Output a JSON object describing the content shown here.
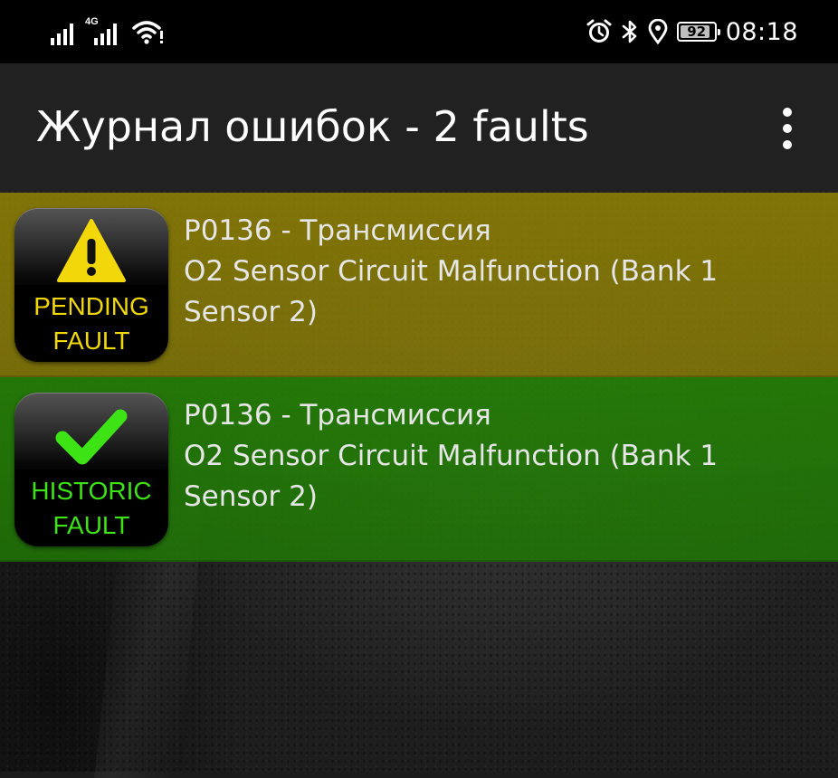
{
  "status_bar": {
    "time": "08:18",
    "battery_level": "92",
    "network_label": "4G",
    "icons": [
      "signal-icon",
      "4g-signal-icon",
      "wifi-icon",
      "alarm-icon",
      "bluetooth-icon",
      "location-icon",
      "battery-icon"
    ],
    "text_color": "#ffffff"
  },
  "app_bar": {
    "title": "Журнал ошибок - 2 faults",
    "menu_icon": "more-vert-icon",
    "background": "#212121"
  },
  "faults": [
    {
      "status": "pending",
      "badge_line1": "PENDING",
      "badge_line2": "FAULT",
      "badge_icon": "warning-icon",
      "badge_text_color": "#f2d80a",
      "code_line": "P0136 - Трансмиссия",
      "description": "O2 Sensor Circuit Malfunction (Bank 1 Sensor 2)",
      "row_color": "#948400"
    },
    {
      "status": "historic",
      "badge_line1": "HISTORIC",
      "badge_line2": "FAULT",
      "badge_icon": "checkmark-icon",
      "badge_text_color": "#3ee316",
      "code_line": "P0136 - Трансмиссия",
      "description": "O2 Sensor Circuit Malfunction (Bank 1 Sensor 2)",
      "row_color": "#248204"
    }
  ]
}
